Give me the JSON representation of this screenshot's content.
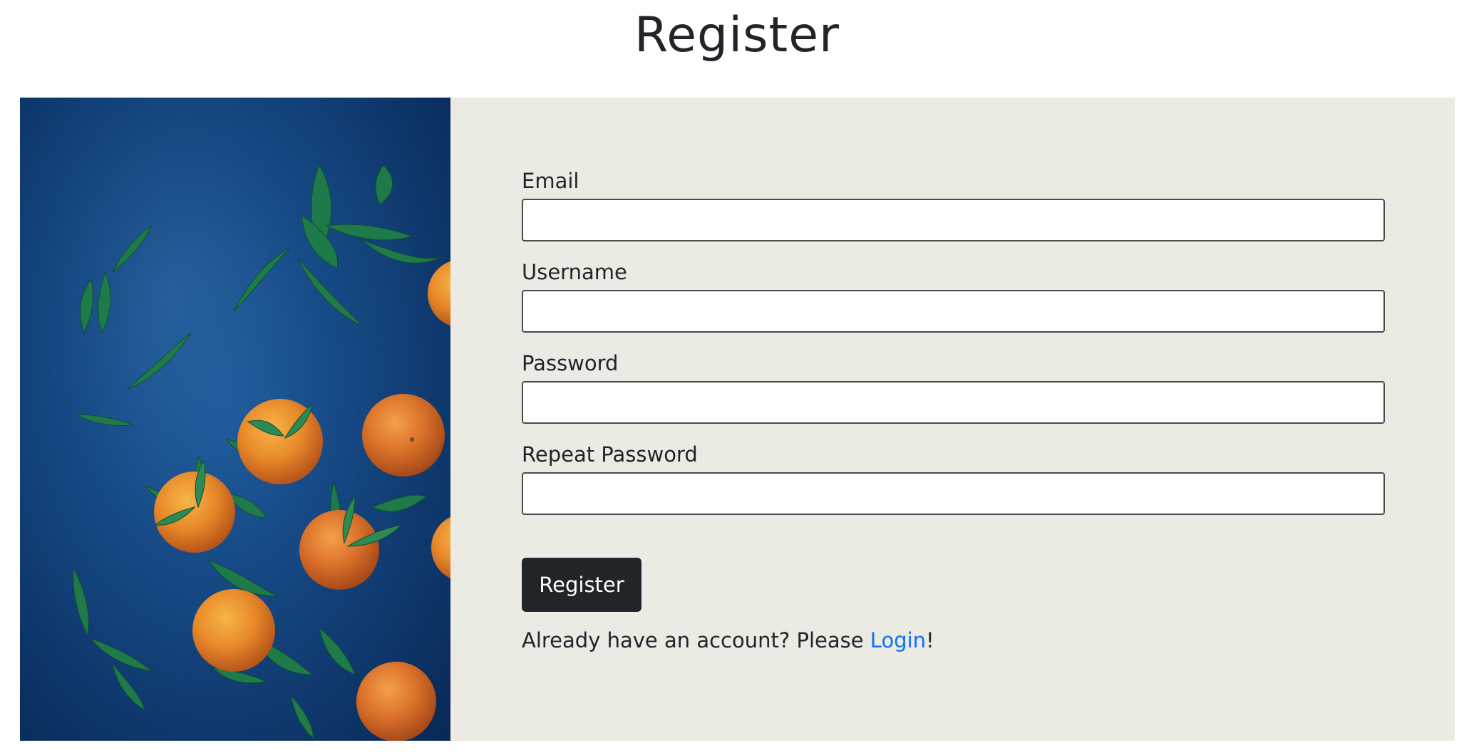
{
  "page": {
    "title": "Register"
  },
  "form": {
    "email_label": "Email",
    "email_value": "",
    "username_label": "Username",
    "username_value": "",
    "password_label": "Password",
    "password_value": "",
    "repeat_password_label": "Repeat Password",
    "repeat_password_value": "",
    "submit_label": "Register"
  },
  "footer": {
    "prompt_text": "Already have an account? Please ",
    "login_link": "Login",
    "suffix": "!"
  },
  "colors": {
    "form_background": "#ebebe3",
    "button_background": "#212529",
    "link": "#0d6efd",
    "photo_background": "#144a8a",
    "orange": "#e8892a",
    "leaf": "#1f7a4a"
  },
  "image": {
    "subject": "oranges-with-leaves-on-blue-background"
  }
}
